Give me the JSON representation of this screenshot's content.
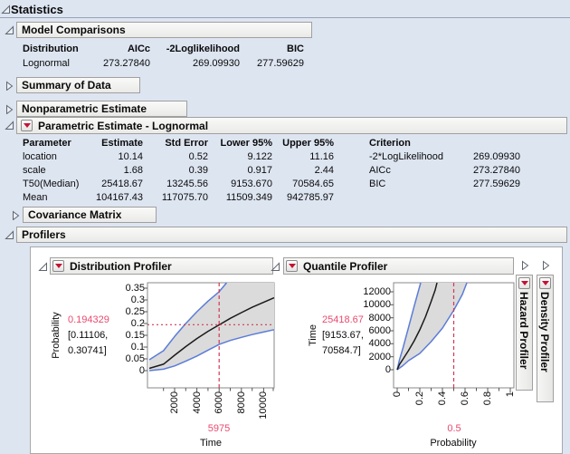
{
  "page": {
    "title": "Statistics"
  },
  "model_comparisons": {
    "title": "Model Comparisons",
    "columns": {
      "distribution": "Distribution",
      "aicc": "AICc",
      "loglik": "-2Loglikelihood",
      "bic": "BIC"
    },
    "row": {
      "distribution": "Lognormal",
      "aicc": "273.27840",
      "loglik": "269.09930",
      "bic": "277.59629"
    }
  },
  "sections": {
    "summary": "Summary of Data",
    "nonparametric": "Nonparametric Estimate",
    "covariance": "Covariance Matrix",
    "profilers": "Profilers"
  },
  "parametric": {
    "title": "Parametric Estimate - Lognormal",
    "columns": {
      "parameter": "Parameter",
      "estimate": "Estimate",
      "std_error": "Std Error",
      "lower": "Lower 95%",
      "upper": "Upper 95%"
    },
    "rows": [
      {
        "parameter": "location",
        "estimate": "10.14",
        "std_error": "0.52",
        "lower": "9.122",
        "upper": "11.16"
      },
      {
        "parameter": "scale",
        "estimate": "1.68",
        "std_error": "0.39",
        "lower": "0.917",
        "upper": "2.44"
      },
      {
        "parameter": "T50(Median)",
        "estimate": "25418.67",
        "std_error": "13245.56",
        "lower": "9153.670",
        "upper": "70584.65"
      },
      {
        "parameter": "Mean",
        "estimate": "104167.43",
        "std_error": "117075.70",
        "lower": "11509.349",
        "upper": "942785.97"
      }
    ],
    "criterion": {
      "header": "Criterion",
      "rows": [
        {
          "label": "-2*LogLikelihood",
          "value": "269.09930"
        },
        {
          "label": "AICc",
          "value": "273.27840"
        },
        {
          "label": "BIC",
          "value": "277.59629"
        }
      ]
    }
  },
  "profilers": {
    "distribution": {
      "title": "Distribution Profiler",
      "ylabel": "Probability",
      "value": "0.194329",
      "ci_line1": "[0.11106,",
      "ci_line2": "0.30741]",
      "y_ticks": [
        "0.35",
        "0.3",
        "0.25",
        "0.2",
        "0.15",
        "0.1",
        "0.05",
        "0"
      ],
      "x_ticks": [
        "2000",
        "4000",
        "6000",
        "8000",
        "10000"
      ],
      "x_value": "5975",
      "xlabel": "Time"
    },
    "quantile": {
      "title": "Quantile Profiler",
      "ylabel": "Time",
      "value": "25418.67",
      "ci_line1": "[9153.67,",
      "ci_line2": "70584.7]",
      "y_ticks": [
        "12000",
        "10000",
        "8000",
        "6000",
        "4000",
        "2000",
        "0"
      ],
      "x_ticks": [
        "0",
        "0.2",
        "0.4",
        "0.6",
        "0.8",
        "1"
      ],
      "x_value": "0.5",
      "xlabel": "Probability"
    },
    "hazard": {
      "title": "Hazard Profiler"
    },
    "density": {
      "title": "Density Profiler"
    }
  },
  "colors": {
    "background": "#dde5f1",
    "band_fill": "#dbdbdb",
    "ci_curve": "#5b7cd8",
    "estimate_curve": "#1a1a1a",
    "crosshair": "#d63653",
    "value_text": "#e84a6f",
    "menu_triangle": "#c41230"
  },
  "chart_data": [
    {
      "type": "line",
      "title": "Distribution Profiler",
      "xlabel": "Time",
      "ylabel": "Probability",
      "xlim": [
        0,
        11300
      ],
      "ylim": [
        0,
        0.37
      ],
      "x_ticks": [
        2000,
        4000,
        6000,
        8000,
        10000
      ],
      "y_ticks": [
        0,
        0.05,
        0.1,
        0.15,
        0.2,
        0.25,
        0.3,
        0.35
      ],
      "grid": false,
      "current_point": {
        "x": 5975,
        "y": 0.194329,
        "ci": [
          0.11106,
          0.30741
        ]
      },
      "series": [
        {
          "name": "estimate",
          "x": [
            500,
            1000,
            2000,
            3000,
            4000,
            5000,
            5975,
            7000,
            8000,
            9000,
            10000,
            11000
          ],
          "y": [
            0.01,
            0.027,
            0.065,
            0.102,
            0.136,
            0.167,
            0.194,
            0.222,
            0.246,
            0.269,
            0.29,
            0.31
          ]
        },
        {
          "name": "upper95",
          "x": [
            500,
            1000,
            2000,
            3000,
            4000,
            5000,
            5975,
            6500
          ],
          "y": [
            0.055,
            0.09,
            0.145,
            0.2,
            0.25,
            0.295,
            0.335,
            0.355
          ]
        },
        {
          "name": "lower95",
          "x": [
            500,
            1000,
            2000,
            3000,
            4000,
            5000,
            5975,
            7000,
            8000,
            9000,
            10000,
            11000
          ],
          "y": [
            0.002,
            0.006,
            0.02,
            0.04,
            0.062,
            0.087,
            0.111,
            0.128,
            0.141,
            0.153,
            0.164,
            0.174
          ]
        }
      ]
    },
    {
      "type": "line",
      "title": "Quantile Profiler",
      "xlabel": "Probability",
      "ylabel": "Time",
      "xlim": [
        0,
        1
      ],
      "ylim": [
        0,
        13400
      ],
      "x_ticks": [
        0,
        0.2,
        0.4,
        0.6,
        0.8,
        1
      ],
      "y_ticks": [
        0,
        2000,
        4000,
        6000,
        8000,
        10000,
        12000
      ],
      "grid": false,
      "current_point": {
        "x": 0.5,
        "y": 25418.67,
        "ci": [
          9153.67,
          70584.7
        ]
      },
      "series": [
        {
          "name": "estimate",
          "x": [
            0,
            0.05,
            0.1,
            0.15,
            0.2,
            0.25,
            0.3,
            0.35
          ],
          "y": [
            0,
            1600,
            2950,
            4450,
            6160,
            8160,
            10500,
            13240
          ]
        },
        {
          "name": "upper95",
          "x": [
            0,
            0.05,
            0.1,
            0.15,
            0.2
          ],
          "y": [
            0,
            3300,
            6500,
            9800,
            12900
          ]
        },
        {
          "name": "lower95",
          "x": [
            0,
            0.1,
            0.2,
            0.3,
            0.4,
            0.5,
            0.6
          ],
          "y": [
            0,
            1400,
            2500,
            4300,
            6400,
            9154,
            12200
          ]
        }
      ]
    }
  ]
}
